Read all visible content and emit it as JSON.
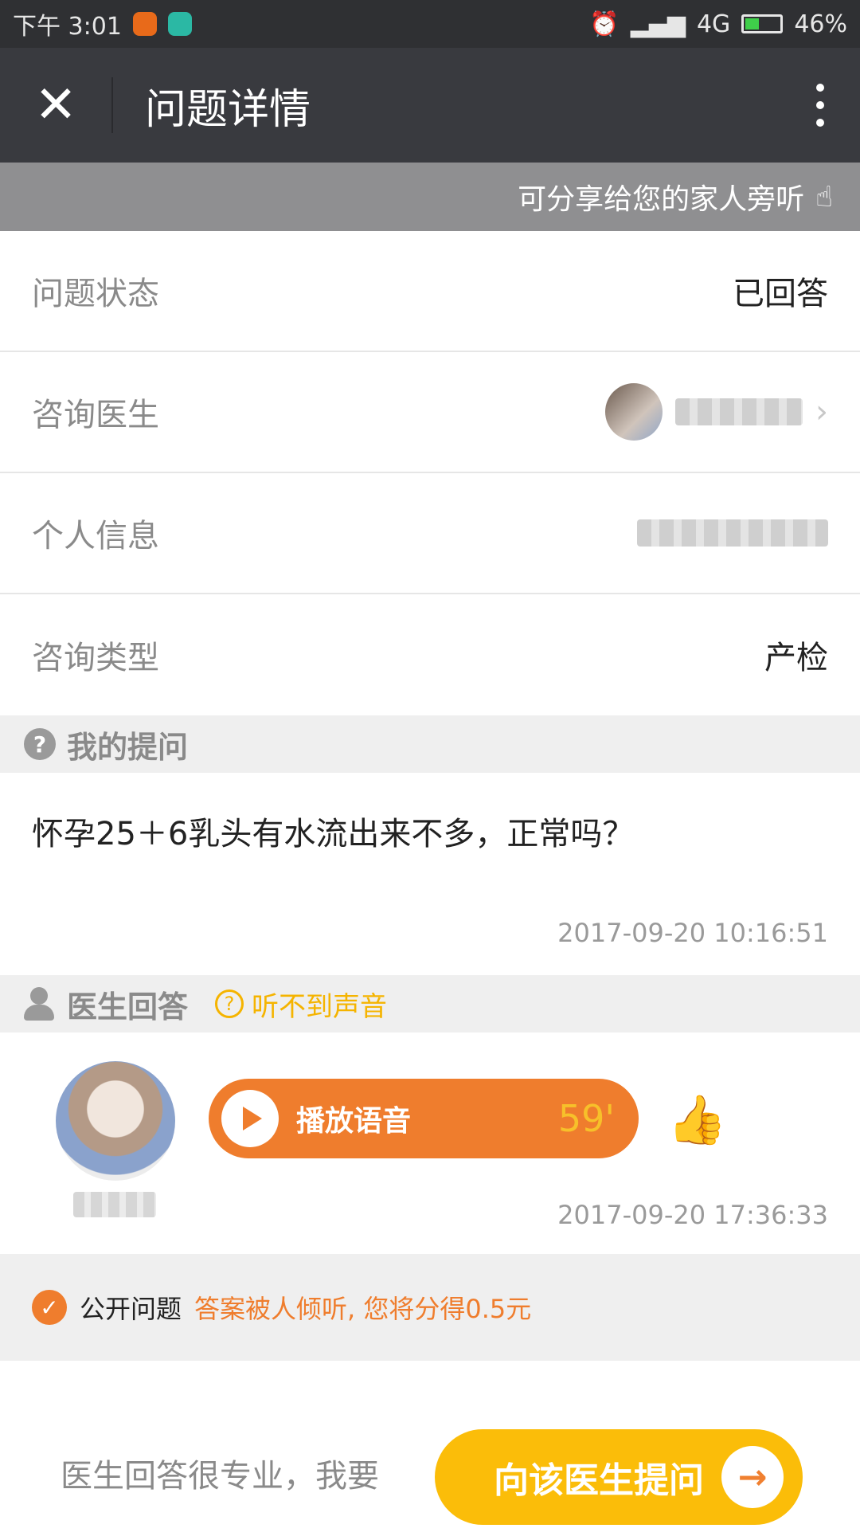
{
  "status_bar": {
    "time": "下午 3:01",
    "network": "4G",
    "battery": "46%",
    "battery_level": 0.46
  },
  "header": {
    "title": "问题详情",
    "close_icon": "close-icon",
    "more_icon": "more-vertical-icon"
  },
  "share_bar": {
    "text": "可分享给您的家人旁听",
    "icon": "hand-pointer-icon"
  },
  "info": {
    "status_label": "问题状态",
    "status_value": "已回答",
    "doctor_label": "咨询医生",
    "personal_label": "个人信息",
    "type_label": "咨询类型",
    "type_value": "产检"
  },
  "my_question": {
    "section_title": "我的提问",
    "text": "怀孕25＋6乳头有水流出来不多，正常吗？",
    "timestamp": "2017-09-20 10:16:51"
  },
  "doctor_answer": {
    "section_title": "医生回答",
    "help_link": "听不到声音",
    "play_label": "播放语音",
    "duration": "59'",
    "timestamp": "2017-09-20 17:36:33"
  },
  "public": {
    "label": "公开问题",
    "note": "答案被人倾听, 您将分得0.5元"
  },
  "bottom": {
    "prompt": "医生回答很专业，我要",
    "ask_button": "向该医生提问",
    "arrow": "→"
  }
}
